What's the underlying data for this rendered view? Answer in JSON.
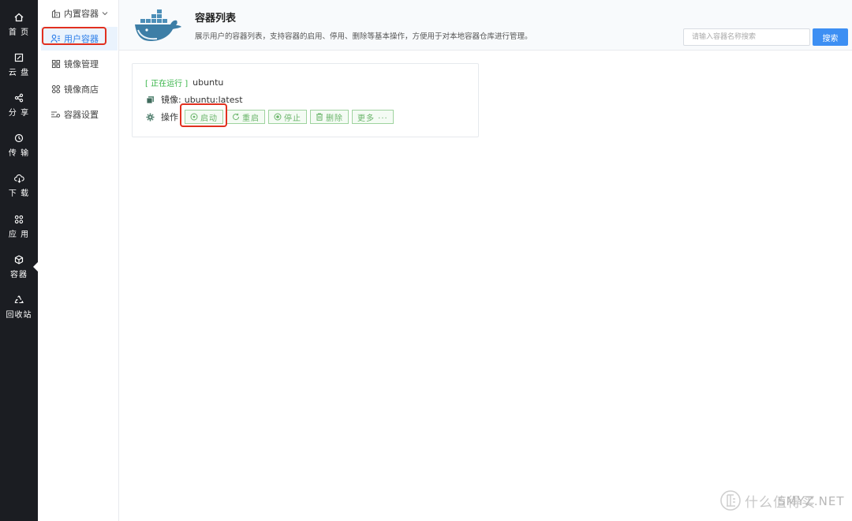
{
  "rail": {
    "items": [
      {
        "label": "首 页",
        "icon": "home-icon"
      },
      {
        "label": "云 盘",
        "icon": "cloud-disk-icon"
      },
      {
        "label": "分 享",
        "icon": "share-icon"
      },
      {
        "label": "传 输",
        "icon": "transfer-icon"
      },
      {
        "label": "下 载",
        "icon": "download-icon"
      },
      {
        "label": "应 用",
        "icon": "apps-icon"
      },
      {
        "label": "容器",
        "icon": "container-icon"
      },
      {
        "label": "回收站",
        "icon": "recycle-icon"
      }
    ],
    "active_index": 6
  },
  "subnav": {
    "items": [
      {
        "label": "内置容器",
        "icon": "builtin-container-icon"
      },
      {
        "label": "用户容器",
        "icon": "user-container-icon"
      },
      {
        "label": "镜像管理",
        "icon": "image-manage-icon"
      },
      {
        "label": "镜像商店",
        "icon": "image-store-icon"
      },
      {
        "label": "容器设置",
        "icon": "settings-icon"
      }
    ],
    "active_index": 1
  },
  "header": {
    "title": "容器列表",
    "description": "展示用户的容器列表，支持容器的启用、停用、删除等基本操作，方便用于对本地容器仓库进行管理。",
    "search_placeholder": "请输入容器名称搜索",
    "search_button": "搜索",
    "logo_icon": "docker-whale-icon"
  },
  "container_card": {
    "status": "[ 正在运行 ]",
    "name": "ubuntu",
    "image_label": "镜像:",
    "image_value": "ubuntu:latest",
    "ops_label": "操作",
    "buttons": [
      {
        "label": "启动",
        "icon": "play-circle-icon"
      },
      {
        "label": "重启",
        "icon": "refresh-icon"
      },
      {
        "label": "停止",
        "icon": "stop-circle-icon"
      },
      {
        "label": "删除",
        "icon": "trash-icon"
      },
      {
        "label": "更多 ···",
        "icon": ""
      }
    ]
  },
  "watermark": {
    "text": "什么值得买",
    "overlay": "SMYZ.NET"
  },
  "colors": {
    "rail_bg": "#1b1d22",
    "accent_blue": "#3d8ff3",
    "status_green": "#3ab54a",
    "highlight_red": "#e1301f"
  }
}
